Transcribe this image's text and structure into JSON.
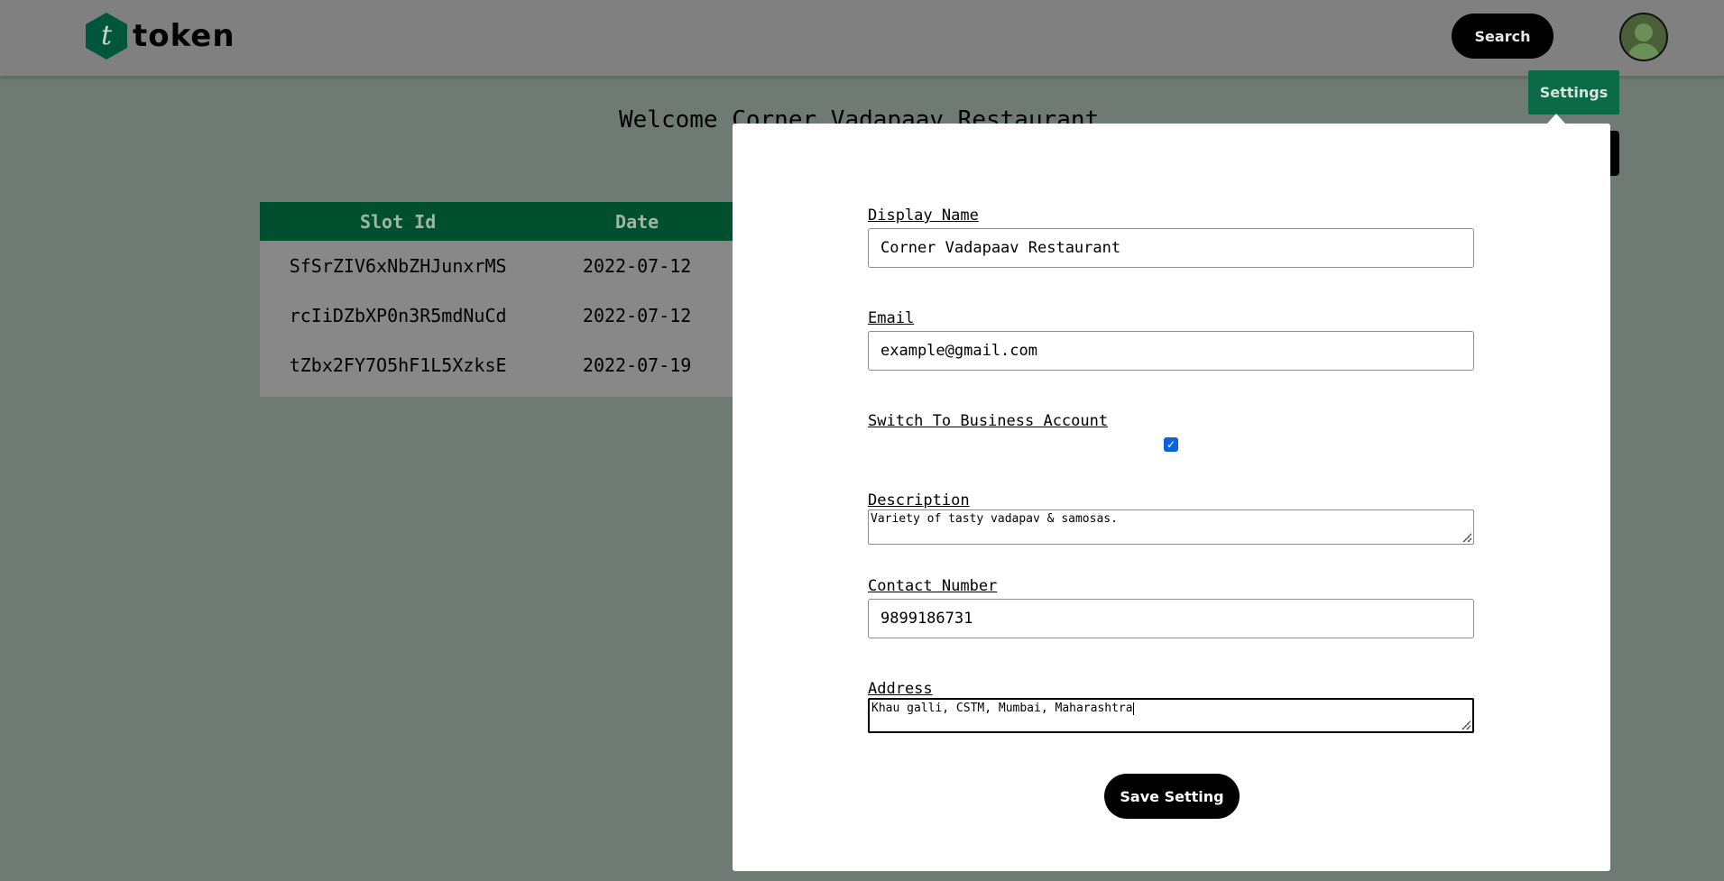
{
  "header": {
    "logo_letter": "t",
    "logo_text": "token",
    "search_label": "Search",
    "settings_label": "Settings"
  },
  "main": {
    "welcome": "Welcome Corner Vadapaav Restaurant",
    "table": {
      "columns": [
        "Slot Id",
        "Date"
      ],
      "rows": [
        [
          "SfSrZIV6xNbZHJunxrMS",
          "2022-07-12"
        ],
        [
          "rcIiDZbXP0n3R5mdNuCd",
          "2022-07-12"
        ],
        [
          "tZbx2FY7O5hF1L5XzksE",
          "2022-07-19"
        ]
      ]
    }
  },
  "modal": {
    "display_name_label": "Display Name",
    "display_name_value": "Corner Vadapaav Restaurant",
    "email_label": "Email",
    "email_value": "example@gmail.com",
    "business_label": "Switch To Business Account",
    "business_checked": true,
    "description_label": "Description",
    "description_value": "Variety of tasty vadapav & samosas.",
    "contact_label": "Contact Number",
    "contact_value": "9899186731",
    "address_label": "Address",
    "address_value": "Khau galli, CSTM, Mumbai, Maharashtra",
    "save_label": "Save Setting"
  },
  "colors": {
    "brand_green": "#00563a",
    "settings_green": "#0b6a47",
    "checkbox_blue": "#0b62d9"
  }
}
